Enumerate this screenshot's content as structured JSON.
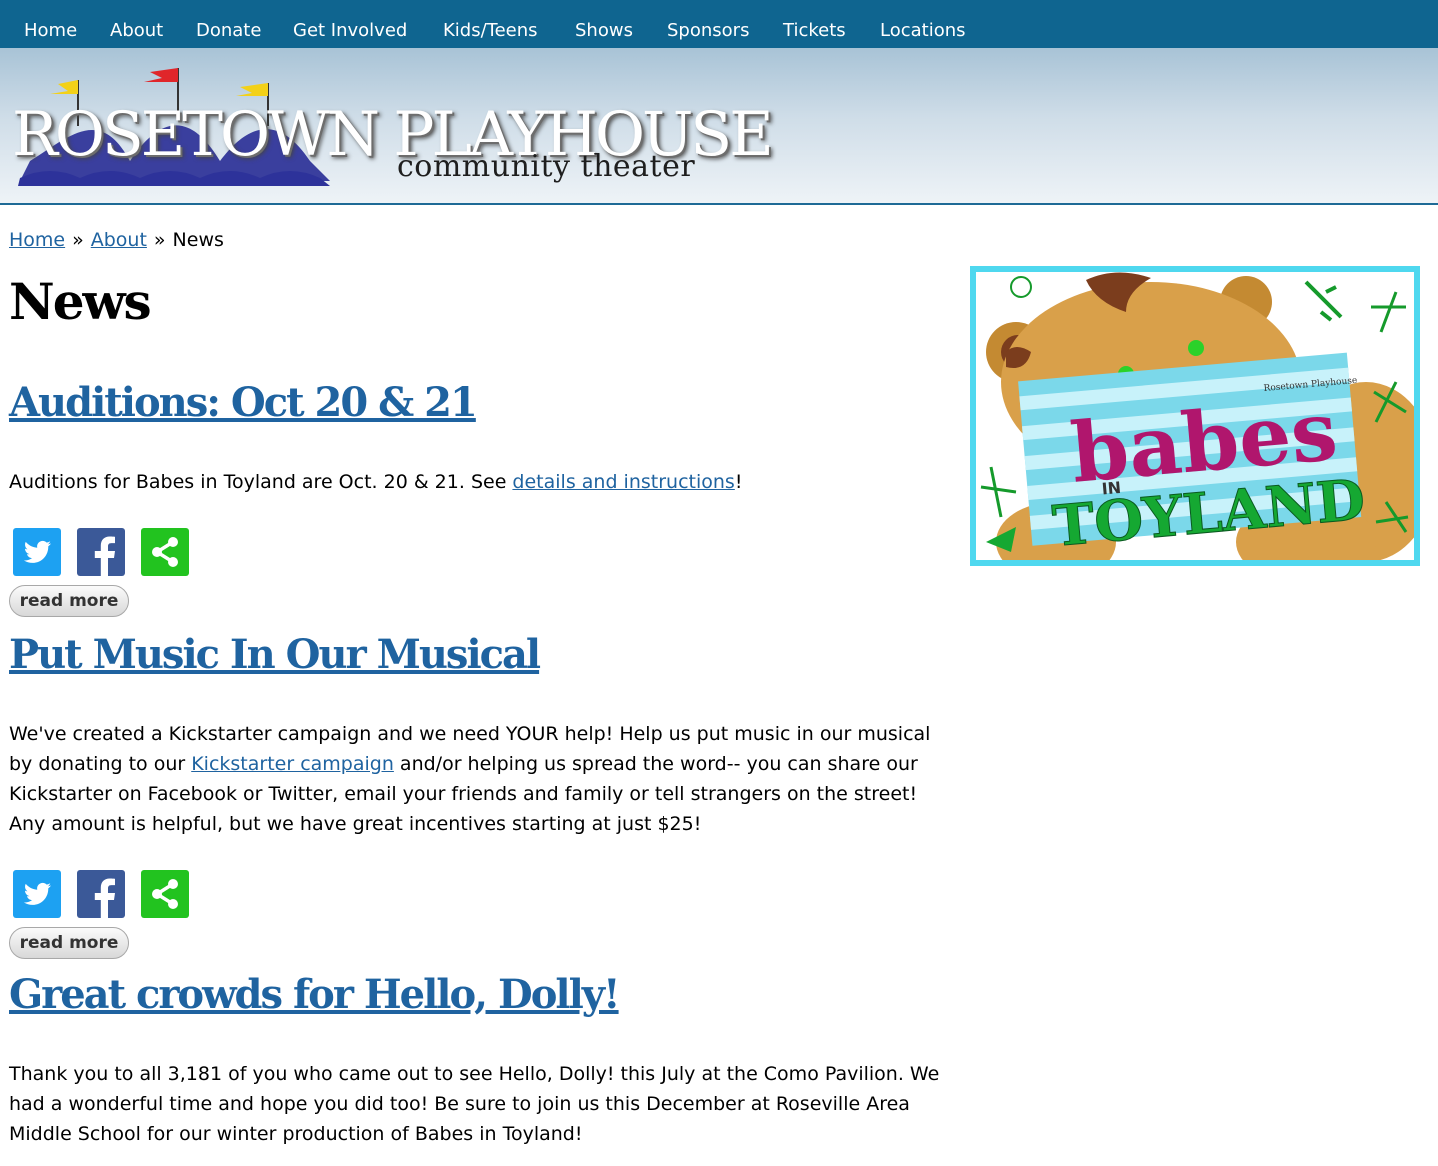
{
  "nav": {
    "items": [
      "Home",
      "About",
      "Donate",
      "Get Involved",
      "Kids/Teens",
      "Shows",
      "Sponsors",
      "Tickets",
      "Locations"
    ]
  },
  "banner": {
    "logo_title": "ROSETOWN PLAYHOUSE",
    "logo_subtitle": "community theater"
  },
  "breadcrumb": {
    "home": "Home",
    "about": "About",
    "current": "News",
    "separator": "»"
  },
  "page": {
    "title": "News"
  },
  "posts": [
    {
      "title": "Auditions: Oct 20 & 21",
      "text_before": "Auditions for Babes in Toyland are Oct. 20 & 21. See ",
      "link": "details and instructions",
      "text_after": "!",
      "read_more": "read more"
    },
    {
      "title": "Put Music In Our Musical",
      "text_before": "We've created a Kickstarter campaign and we need YOUR help! Help us put music in our musical by donating to our ",
      "link": "Kickstarter campaign",
      "text_after": " and/or helping us spread the word-- you can share our Kickstarter on Facebook or Twitter, email your friends and family or tell strangers on the street! Any amount is helpful, but we have great incentives starting at just $25!",
      "read_more": "read more"
    },
    {
      "title": "Great crowds for Hello, Dolly!",
      "text": "Thank you to all 3,181 of you who came out to see Hello, Dolly! this July at the Como Pavilion. We had a wonderful time and hope you did too! Be sure to join us this December at Roseville Area Middle School for our winter production of Babes in Toyland!"
    }
  ],
  "promo": {
    "title_line1": "babes",
    "title_small": "IN",
    "title_line2": "TOYLAND",
    "badge": "Rosetown Playhouse"
  },
  "colors": {
    "nav_bg": "#0f6590",
    "link": "#1f63a0",
    "twitter": "#1da1f2",
    "facebook": "#3b5998",
    "share": "#22c31f",
    "promo_border": "#4fd8ef"
  },
  "icons": [
    "twitter-icon",
    "facebook-icon",
    "share-icon"
  ]
}
